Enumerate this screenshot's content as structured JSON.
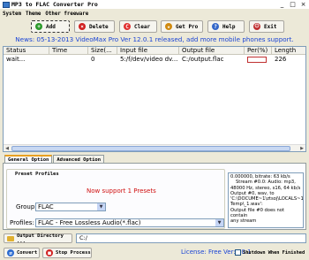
{
  "window": {
    "title": "MP3 to FLAC Converter Pro",
    "controls": [
      "_",
      "□",
      "×"
    ]
  },
  "menu": [
    "System",
    "Theme",
    "Other freeware"
  ],
  "toolbar": {
    "add": "Add",
    "delete": "Delete",
    "clear": "Clear",
    "get_pro": "Get Pro",
    "help": "Help",
    "exit": "Exit"
  },
  "news": "News: 05-13-2013 VideoMax Pro Ver 12.0.1 released, add more mobile phones support.",
  "list": {
    "columns": [
      "Status",
      "Time",
      "Size(...",
      "Input file",
      "Output file",
      "Per(%)",
      "Length"
    ],
    "rows": [
      {
        "status": "wait...",
        "time": "",
        "size": "0",
        "input": "5:/f/dev/video dv...",
        "output": "C:/output.flac",
        "per": 0,
        "length": "226"
      }
    ]
  },
  "tabs": [
    "General Option",
    "Advanced Option"
  ],
  "preset": {
    "group_title": "Preset Profiles",
    "support_text": "Now support 1 Presets",
    "group_label": "Group:",
    "group_value": "FLAC",
    "profiles_label": "Profiles:",
    "profiles_value": "FLAC - Free Lossless Audio(*.flac)"
  },
  "log_lines": [
    "0.000000, bitrate: 63 kb/s",
    "Stream #0.0: Audio: mp3,",
    "48000 Hz, stereo, s16, 64 kb/s",
    "Output #0, wav, to",
    "'C:\\DOCUME~1\\ztsoj\\LOCALS~1\\",
    "Temp\\_1.wav':",
    "Output file #0 does not contain",
    "any stream"
  ],
  "output": {
    "button": "Output Directory ...",
    "path": "C:/"
  },
  "bottom": {
    "convert": "Convert",
    "stop": "Stop Process",
    "license": "License: Free Ver:2.0.1",
    "shutdown": "Shutdown When Finished"
  },
  "colors": {
    "accent_blue": "#1a44d6",
    "support_red": "#d01010",
    "background": "#ece9d8"
  }
}
